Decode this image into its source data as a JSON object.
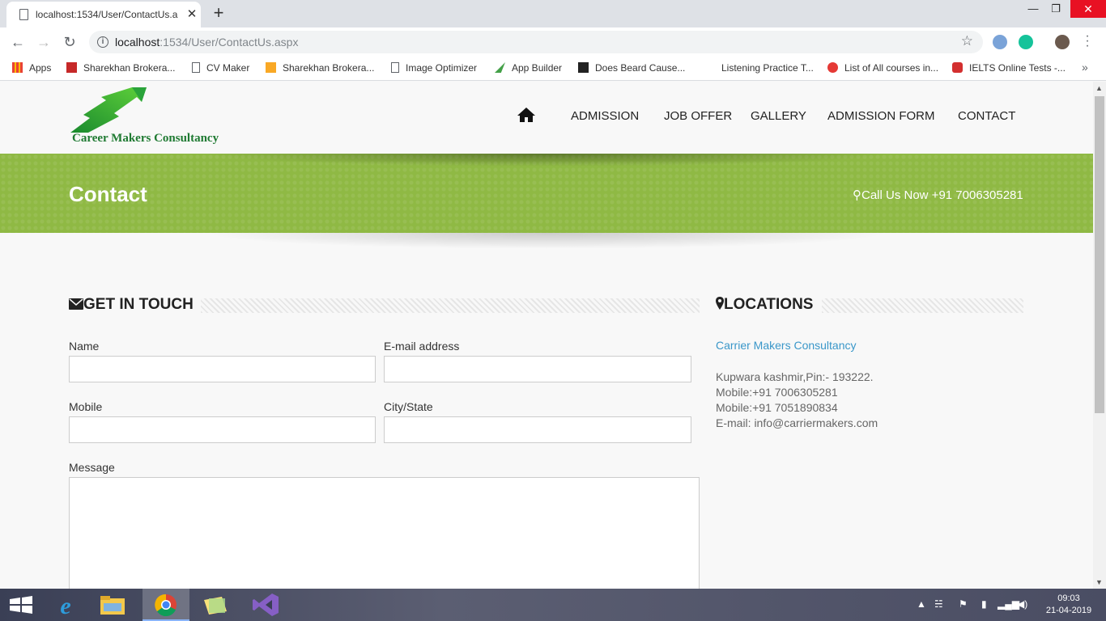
{
  "browser": {
    "tab_title": "localhost:1534/User/ContactUs.a",
    "url_host": "localhost",
    "url_rest": ":1534/User/ContactUs.aspx",
    "bookmarks": [
      {
        "label": "Apps"
      },
      {
        "label": "Sharekhan Brokera..."
      },
      {
        "label": "CV Maker"
      },
      {
        "label": "Sharekhan Brokera..."
      },
      {
        "label": "Image Optimizer"
      },
      {
        "label": "App Builder"
      },
      {
        "label": "Does Beard Cause..."
      },
      {
        "label": "Listening Practice T..."
      },
      {
        "label": "List of All courses in..."
      },
      {
        "label": "IELTS Online Tests -..."
      }
    ]
  },
  "site": {
    "logo_text": "Career Makers Consultancy",
    "nav": {
      "admission": "ADMISSION",
      "job_offer": "JOB OFFER",
      "gallery": "GALLERY",
      "admission_form": "ADMISSION FORM",
      "contact": "CONTACT"
    },
    "banner": {
      "title": "Contact",
      "call": "Call Us Now +91 7006305281"
    },
    "form": {
      "heading": "GET IN TOUCH",
      "name_label": "Name",
      "email_label": "E-mail address",
      "mobile_label": "Mobile",
      "city_label": "City/State",
      "message_label": "Message",
      "name_value": "",
      "email_value": "",
      "mobile_value": "",
      "city_value": "",
      "message_value": ""
    },
    "locations": {
      "heading": "LOCATIONS",
      "name": "Carrier Makers Consultancy",
      "address": "Kupwara kashmir,Pin:- 193222.",
      "mobile1": "Mobile:+91 7006305281",
      "mobile2": "Mobile:+91 7051890834",
      "email": "E-mail: info@carriermakers.com"
    }
  },
  "taskbar": {
    "time": "09:03",
    "date": "21-04-2019"
  },
  "colors": {
    "banner": "#8fb944",
    "link": "#3a97c9",
    "logo": "#1f7a32"
  }
}
